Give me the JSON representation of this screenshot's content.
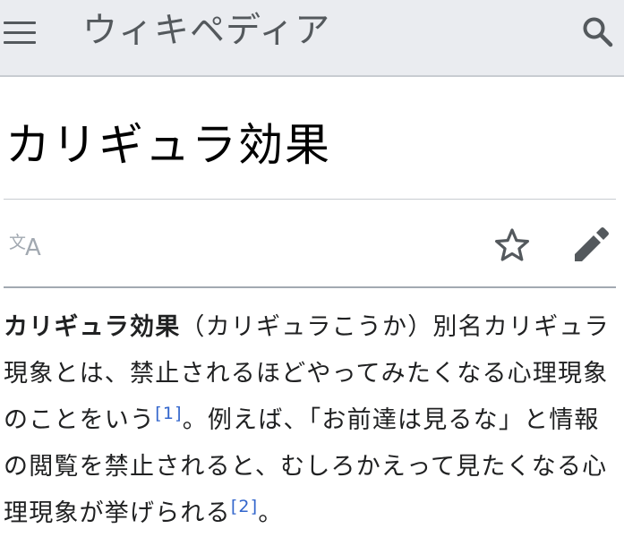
{
  "header": {
    "site_title": "ウィキペディア"
  },
  "page": {
    "title": "カリギュラ効果"
  },
  "toolbar": {
    "language_icon_glyph": "文",
    "language_icon_letter": "A"
  },
  "article": {
    "term": "カリギュラ効果",
    "text_1": "（カリギュラこうか）別名カリギュラ現象とは、禁止されるほどやってみたくなる心理現象のことをいう",
    "ref_1": "[1]",
    "text_2": "。例えば、「お前達は見るな」と情報の閲覧を禁止されると、むしろかえって見たくなる心理現象が挙げられる",
    "ref_2": "[2]",
    "text_3": "。"
  },
  "colors": {
    "header_bg": "#eaecf0",
    "icon_gray": "#54595d",
    "link_blue": "#3366cc",
    "muted_icon": "#a2a9b1"
  }
}
